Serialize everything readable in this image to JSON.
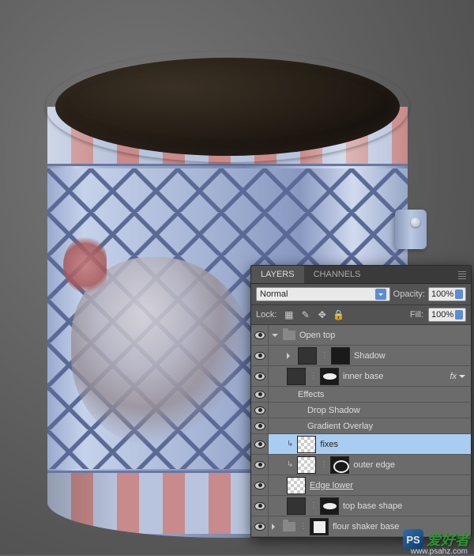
{
  "panel": {
    "tabs": {
      "layers": "LAYERS",
      "channels": "CHANNELS"
    },
    "blend_mode": "Normal",
    "opacity_label": "Opacity:",
    "opacity_value": "100%",
    "lock_label": "Lock:",
    "fill_label": "Fill:",
    "fill_value": "100%"
  },
  "layers": {
    "group_open_top": "Open top",
    "shadow": "Shadow",
    "inner_base": "inner base",
    "fx_label": "fx",
    "effects": "Effects",
    "drop_shadow": "Drop Shadow",
    "gradient_overlay": "Gradient Overlay",
    "fixes": "fixes",
    "outer_edge": "outer edge",
    "edge_lower": "Edge lower",
    "top_base_shape": "top base shape",
    "flour_shaker_base": "flour shaker base"
  },
  "watermark": {
    "logo": "PS",
    "text": "爱好者",
    "url": "www.psahz.com"
  }
}
